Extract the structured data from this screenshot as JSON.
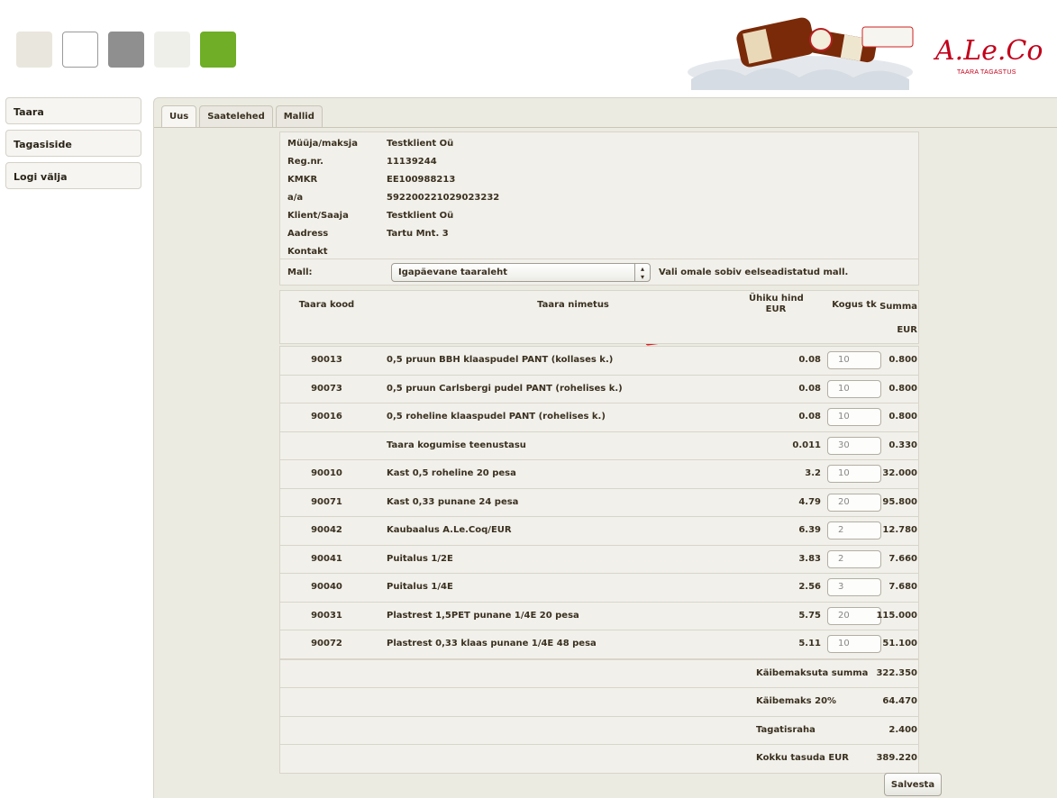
{
  "swatches": [
    "#e9e6dd",
    "#ffffff",
    "#8f8f8f",
    "#efefea",
    "#6fae26"
  ],
  "logo": {
    "script": "A.Le.Coq",
    "sub": "TAARA TAGASTUS"
  },
  "sidebar": {
    "items": [
      "Taara",
      "Tagasiside",
      "Logi välja"
    ]
  },
  "tabs": [
    "Uus",
    "Saatelehed",
    "Mallid"
  ],
  "info": [
    {
      "label": "Müüja/maksja",
      "value": "Testklient Oü"
    },
    {
      "label": "Reg.nr.",
      "value": "11139244"
    },
    {
      "label": "KMKR",
      "value": "EE100988213"
    },
    {
      "label": "a/a",
      "value": "592200221029023232"
    },
    {
      "label": "Klient/Saaja",
      "value": "Testklient Oü"
    },
    {
      "label": "Aadress",
      "value": "Tartu Mnt. 3"
    },
    {
      "label": "Kontakt",
      "value": ""
    }
  ],
  "mall": {
    "label": "Mall:",
    "selected": "Igapäevane taaraleht",
    "hint": "Vali omale sobiv eelseadistatud mall."
  },
  "table": {
    "headers": {
      "code": "Taara kood",
      "name": "Taara nimetus",
      "price1": "Ühiku hind",
      "price2": "EUR",
      "qty": "Kogus tk",
      "sum1": "Summa",
      "sum2": "EUR"
    },
    "rows": [
      {
        "code": "90013",
        "name": "0,5 pruun BBH klaaspudel PANT (kollases k.)",
        "price": "0.08",
        "qty": "10",
        "sum": "0.800"
      },
      {
        "code": "90073",
        "name": "0,5 pruun Carlsbergi pudel PANT (rohelises k.)",
        "price": "0.08",
        "qty": "10",
        "sum": "0.800"
      },
      {
        "code": "90016",
        "name": "0,5 roheline klaaspudel PANT (rohelises k.)",
        "price": "0.08",
        "qty": "10",
        "sum": "0.800"
      },
      {
        "code": "",
        "name": "Taara kogumise teenustasu",
        "price": "0.011",
        "qty": "30",
        "sum": "0.330"
      },
      {
        "code": "90010",
        "name": "Kast 0,5 roheline 20 pesa",
        "price": "3.2",
        "qty": "10",
        "sum": "32.000"
      },
      {
        "code": "90071",
        "name": "Kast 0,33 punane 24 pesa",
        "price": "4.79",
        "qty": "20",
        "sum": "95.800"
      },
      {
        "code": "90042",
        "name": "Kaubaalus A.Le.Coq/EUR",
        "price": "6.39",
        "qty": "2",
        "sum": "12.780"
      },
      {
        "code": "90041",
        "name": "Puitalus 1/2E",
        "price": "3.83",
        "qty": "2",
        "sum": "7.660"
      },
      {
        "code": "90040",
        "name": "Puitalus 1/4E",
        "price": "2.56",
        "qty": "3",
        "sum": "7.680"
      },
      {
        "code": "90031",
        "name": "Plastrest 1,5PET punane 1/4E 20 pesa",
        "price": "5.75",
        "qty": "20",
        "sum": "115.000"
      },
      {
        "code": "90072",
        "name": "Plastrest 0,33 klaas punane 1/4E 48 pesa",
        "price": "5.11",
        "qty": "10",
        "sum": "51.100"
      }
    ],
    "totals": [
      {
        "label": "Käibemaksuta summa",
        "value": "322.350"
      },
      {
        "label": "Käibemaks 20%",
        "value": "64.470"
      },
      {
        "label": "Tagatisraha",
        "value": "2.400"
      },
      {
        "label": "Kokku tasuda EUR",
        "value": "389.220"
      }
    ]
  },
  "save_label": "Salvesta"
}
